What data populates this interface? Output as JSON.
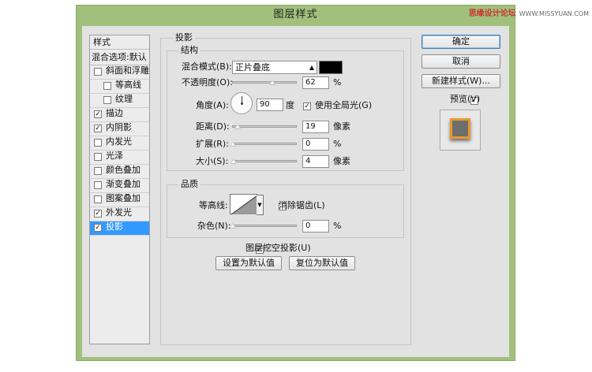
{
  "window": {
    "title": "图层样式",
    "watermark": {
      "text": "思缘设计论坛",
      "url": "WWW.MISSYUAN.COM"
    }
  },
  "styles_panel": {
    "header": "样式",
    "blend_options": "混合选项:默认",
    "items": [
      {
        "label": "斜面和浮雕",
        "checked": false,
        "indent": false
      },
      {
        "label": "等高线",
        "checked": false,
        "indent": true
      },
      {
        "label": "纹理",
        "checked": false,
        "indent": true
      },
      {
        "label": "描边",
        "checked": true,
        "indent": false
      },
      {
        "label": "内阴影",
        "checked": true,
        "indent": false
      },
      {
        "label": "内发光",
        "checked": false,
        "indent": false
      },
      {
        "label": "光泽",
        "checked": false,
        "indent": false
      },
      {
        "label": "颜色叠加",
        "checked": false,
        "indent": false
      },
      {
        "label": "渐变叠加",
        "checked": false,
        "indent": false
      },
      {
        "label": "图案叠加",
        "checked": false,
        "indent": false
      },
      {
        "label": "外发光",
        "checked": true,
        "indent": false
      },
      {
        "label": "投影",
        "checked": true,
        "indent": false,
        "selected": true
      }
    ]
  },
  "drop_shadow": {
    "title": "投影",
    "structure": {
      "title": "结构",
      "blend_mode_label": "混合模式(B):",
      "blend_mode_value": "正片叠底",
      "shadow_color": "#000000",
      "opacity_label": "不透明度(O):",
      "opacity_value": "62",
      "opacity_percent": 62,
      "angle_label": "角度(A):",
      "angle_value": "90",
      "angle_unit": "度",
      "global_light_label": "使用全局光(G)",
      "global_light_checked": true,
      "distance_label": "距离(D):",
      "distance_value": "19",
      "distance_unit": "像素",
      "distance_fraction": 0.08,
      "spread_label": "扩展(R):",
      "spread_value": "0",
      "spread_unit": "%",
      "size_label": "大小(S):",
      "size_value": "4",
      "size_unit": "像素",
      "size_fraction": 0.02
    },
    "quality": {
      "title": "品质",
      "contour_label": "等高线:",
      "antialias_label": "消除锯齿(L)",
      "antialias_checked": false,
      "noise_label": "杂色(N):",
      "noise_value": "0",
      "noise_unit": "%"
    },
    "knockout_label": "图层挖空投影(U)",
    "knockout_checked": true,
    "set_default_label": "设置为默认值",
    "reset_default_label": "复位为默认值",
    "opacity_unit": "%"
  },
  "buttons": {
    "ok": "确定",
    "cancel": "取消",
    "new_style": "新建样式(W)...",
    "preview_label": "预览(V)",
    "preview_checked": true
  },
  "colors": {
    "frame": "#a0c07c",
    "selection": "#3399ff",
    "preview_stroke": "#e89a2c"
  }
}
